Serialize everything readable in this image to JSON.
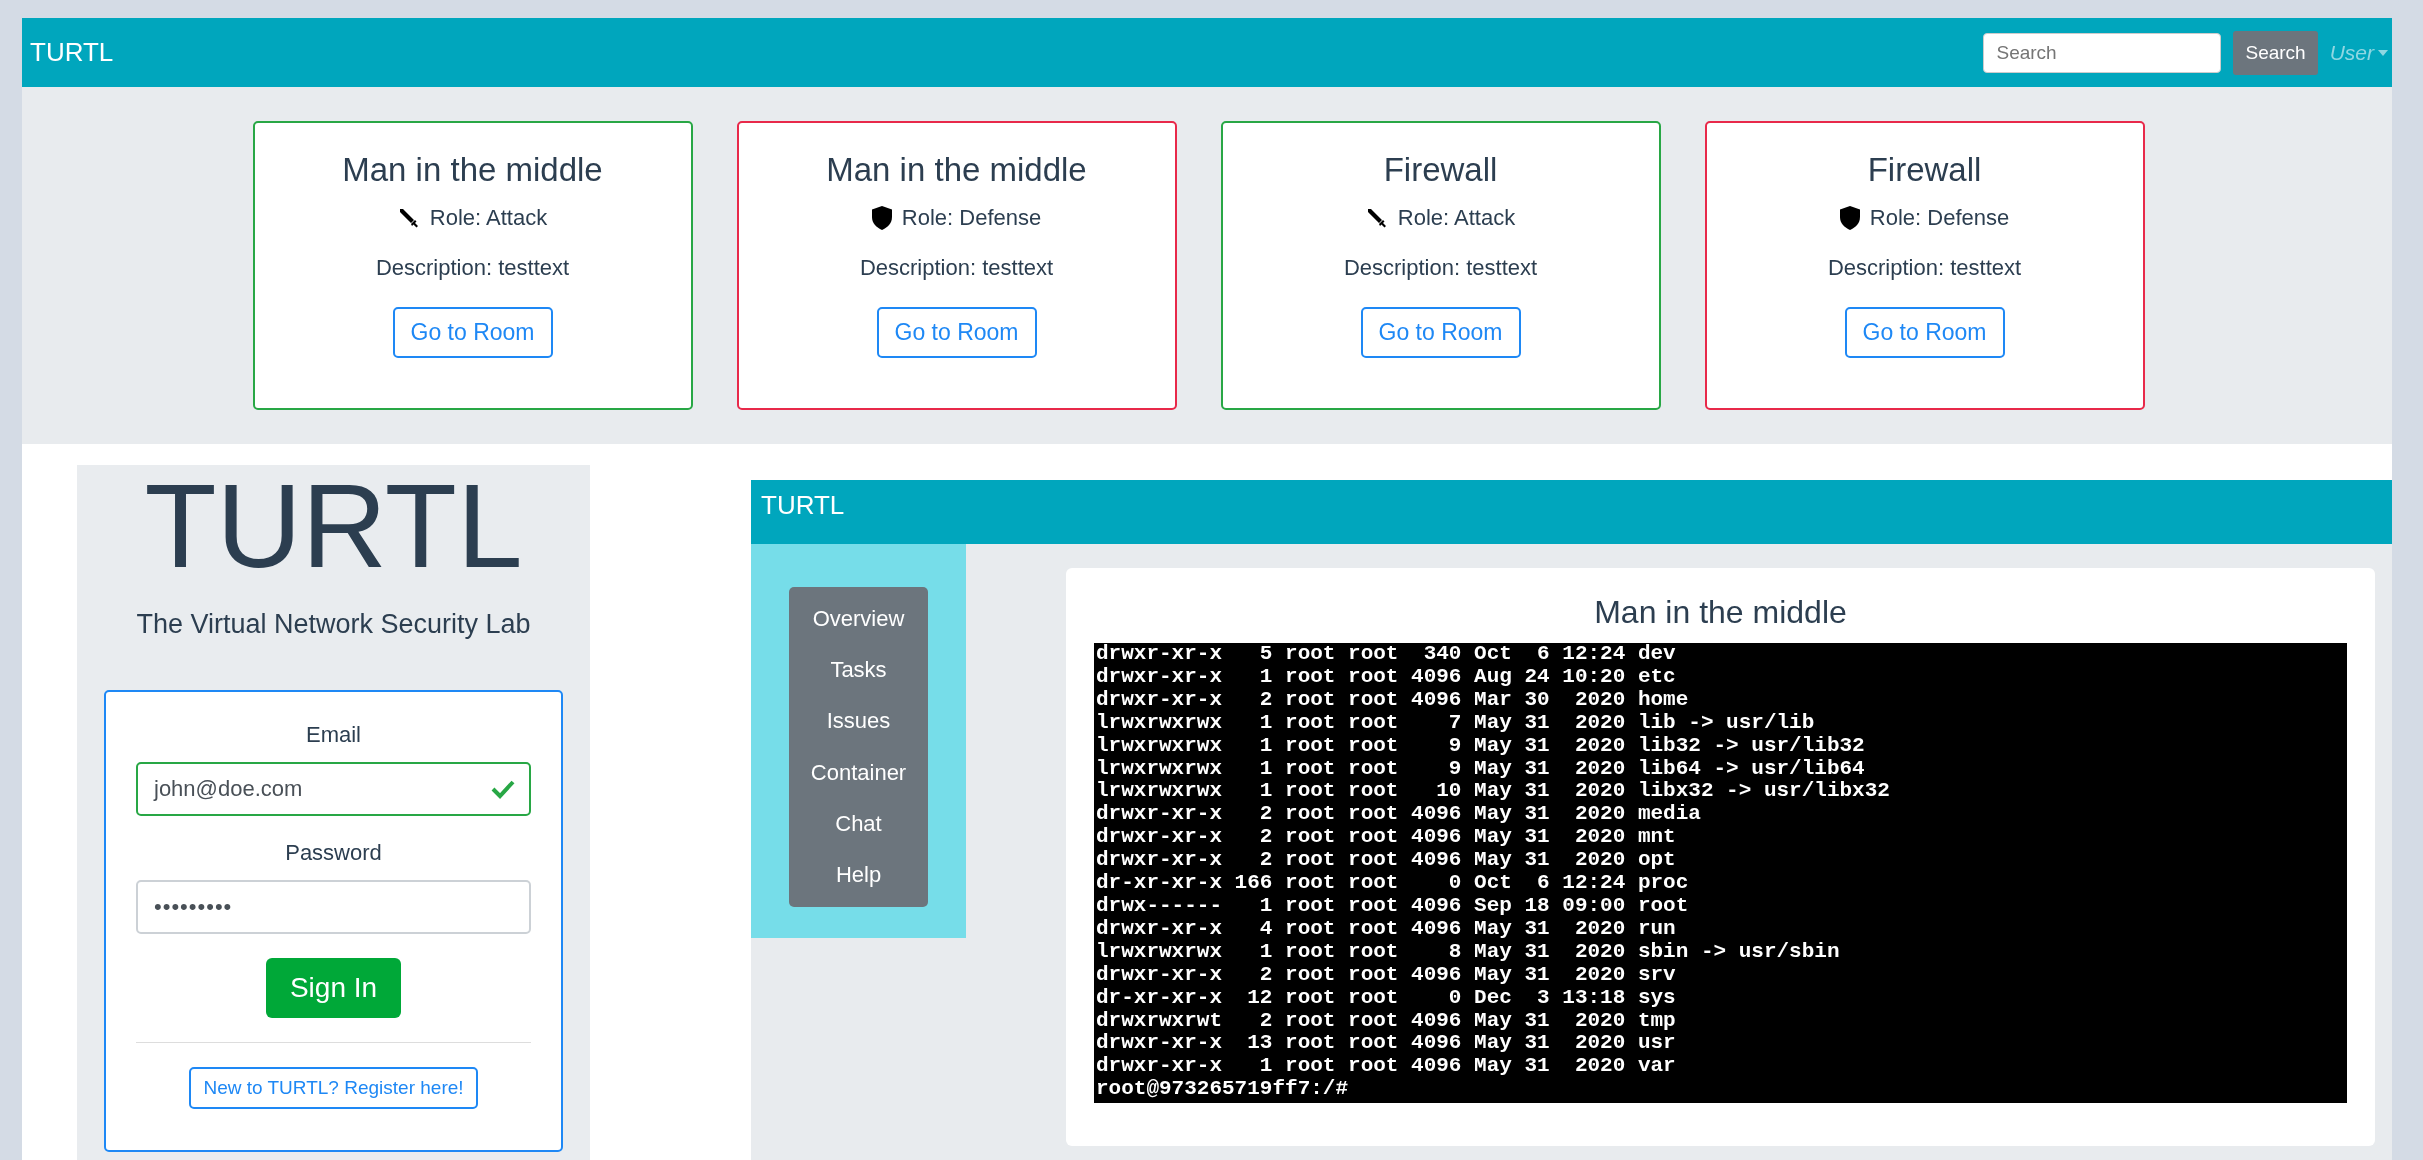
{
  "navbar": {
    "brand": "TURTL",
    "search": {
      "placeholder": "Search"
    },
    "search_button": "Search",
    "user_menu": "User"
  },
  "rooms": [
    {
      "title": "Man in the middle",
      "kind": "attack",
      "role": "Role: Attack",
      "description": "Description: testtext",
      "button": "Go to Room"
    },
    {
      "title": "Man in the middle",
      "kind": "defense",
      "role": "Role: Defense",
      "description": "Description: testtext",
      "button": "Go to Room"
    },
    {
      "title": "Firewall",
      "kind": "attack",
      "role": "Role: Attack",
      "description": "Description: testtext",
      "button": "Go to Room"
    },
    {
      "title": "Firewall",
      "kind": "defense",
      "role": "Role: Defense",
      "description": "Description: testtext",
      "button": "Go to Room"
    }
  ],
  "login": {
    "logo": "TURTL",
    "subtitle": "The Virtual Network Security Lab",
    "email_label": "Email",
    "email": {
      "value": "john@doe.com",
      "valid": true
    },
    "password_label": "Password",
    "password": {
      "value": "•••••••••"
    },
    "sign_in": "Sign In",
    "register": "New to TURTL? Register here!"
  },
  "room_view": {
    "brand": "TURTL",
    "menu": [
      {
        "label": "Overview"
      },
      {
        "label": "Tasks"
      },
      {
        "label": "Issues"
      },
      {
        "label": "Container"
      },
      {
        "label": "Chat"
      },
      {
        "label": "Help"
      }
    ],
    "title": "Man in the middle",
    "terminal": [
      "drwxr-xr-x   5 root root  340 Oct  6 12:24 dev",
      "drwxr-xr-x   1 root root 4096 Aug 24 10:20 etc",
      "drwxr-xr-x   2 root root 4096 Mar 30  2020 home",
      "lrwxrwxrwx   1 root root    7 May 31  2020 lib -> usr/lib",
      "lrwxrwxrwx   1 root root    9 May 31  2020 lib32 -> usr/lib32",
      "lrwxrwxrwx   1 root root    9 May 31  2020 lib64 -> usr/lib64",
      "lrwxrwxrwx   1 root root   10 May 31  2020 libx32 -> usr/libx32",
      "drwxr-xr-x   2 root root 4096 May 31  2020 media",
      "drwxr-xr-x   2 root root 4096 May 31  2020 mnt",
      "drwxr-xr-x   2 root root 4096 May 31  2020 opt",
      "dr-xr-xr-x 166 root root    0 Oct  6 12:24 proc",
      "drwx------   1 root root 4096 Sep 18 09:00 root",
      "drwxr-xr-x   4 root root 4096 May 31  2020 run",
      "lrwxrwxrwx   1 root root    8 May 31  2020 sbin -> usr/sbin",
      "drwxr-xr-x   2 root root 4096 May 31  2020 srv",
      "dr-xr-xr-x  12 root root    0 Dec  3 13:18 sys",
      "drwxrwxrwt   2 root root 4096 May 31  2020 tmp",
      "drwxr-xr-x  13 root root 4096 May 31  2020 usr",
      "drwxr-xr-x   1 root root 4096 May 31  2020 var",
      "root@973265719ff7:/#"
    ]
  }
}
